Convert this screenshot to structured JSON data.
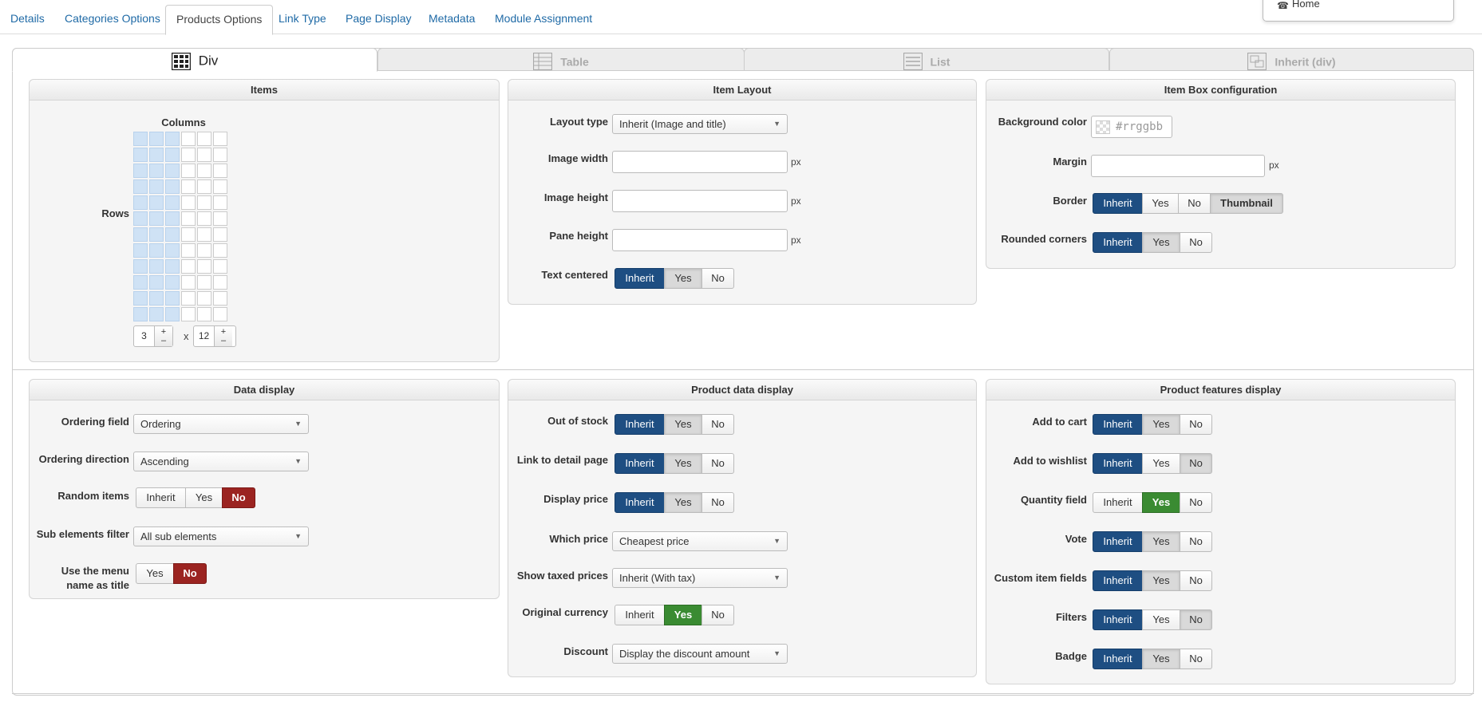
{
  "top_tabs": [
    "Details",
    "Categories Options",
    "Products Options",
    "Link Type",
    "Page Display",
    "Metadata",
    "Module Assignment"
  ],
  "home_menu": {
    "label": "Home",
    "icon": "home-icon"
  },
  "layout_tabs": [
    "Div",
    "Table",
    "List",
    "Inherit (div)"
  ],
  "items": {
    "title": "Items",
    "columns_label": "Columns",
    "rows_label": "Rows",
    "columns": "3",
    "rows": "12",
    "times": "x",
    "plus": "+",
    "minus": "–"
  },
  "item_layout": {
    "title": "Item Layout",
    "layout_type": {
      "label": "Layout type",
      "value": "Inherit (Image and title)"
    },
    "image_width": {
      "label": "Image width",
      "unit": "px"
    },
    "image_height": {
      "label": "Image height",
      "unit": "px"
    },
    "pane_height": {
      "label": "Pane height",
      "unit": "px"
    },
    "text_centered": {
      "label": "Text centered",
      "options": [
        "Inherit",
        "Yes",
        "No"
      ]
    }
  },
  "item_box": {
    "title": "Item Box configuration",
    "background_color": {
      "label": "Background color",
      "placeholder": "#rrggbb"
    },
    "margin": {
      "label": "Margin",
      "unit": "px"
    },
    "border": {
      "label": "Border",
      "options": [
        "Inherit",
        "Yes",
        "No",
        "Thumbnail"
      ]
    },
    "rounded_corners": {
      "label": "Rounded corners",
      "options": [
        "Inherit",
        "Yes",
        "No"
      ]
    }
  },
  "data_display": {
    "title": "Data display",
    "ordering_field": {
      "label": "Ordering field",
      "value": "Ordering"
    },
    "ordering_direction": {
      "label": "Ordering direction",
      "value": "Ascending"
    },
    "random_items": {
      "label": "Random items",
      "options": [
        "Inherit",
        "Yes",
        "No"
      ]
    },
    "sub_elements_filter": {
      "label": "Sub elements filter",
      "value": "All sub elements"
    },
    "menu_name_title": {
      "label_line1": "Use the menu",
      "label_line2": "name as title",
      "options": [
        "Yes",
        "No"
      ]
    }
  },
  "product_data_display": {
    "title": "Product data display",
    "out_of_stock": {
      "label": "Out of stock",
      "options": [
        "Inherit",
        "Yes",
        "No"
      ]
    },
    "link_to_detail": {
      "label": "Link to detail page",
      "options": [
        "Inherit",
        "Yes",
        "No"
      ]
    },
    "display_price": {
      "label": "Display price",
      "options": [
        "Inherit",
        "Yes",
        "No"
      ]
    },
    "which_price": {
      "label": "Which price",
      "value": "Cheapest price"
    },
    "show_taxed": {
      "label": "Show taxed prices",
      "value": "Inherit (With tax)"
    },
    "original_currency": {
      "label": "Original currency",
      "options": [
        "Inherit",
        "Yes",
        "No"
      ]
    },
    "discount": {
      "label": "Discount",
      "value": "Display the discount amount"
    }
  },
  "product_features": {
    "title": "Product features display",
    "add_to_cart": {
      "label": "Add to cart",
      "options": [
        "Inherit",
        "Yes",
        "No"
      ]
    },
    "add_to_wishlist": {
      "label": "Add to wishlist",
      "options": [
        "Inherit",
        "Yes",
        "No"
      ]
    },
    "quantity_field": {
      "label": "Quantity field",
      "options": [
        "Inherit",
        "Yes",
        "No"
      ]
    },
    "vote": {
      "label": "Vote",
      "options": [
        "Inherit",
        "Yes",
        "No"
      ]
    },
    "custom_item_fields": {
      "label": "Custom item fields",
      "options": [
        "Inherit",
        "Yes",
        "No"
      ]
    },
    "filters": {
      "label": "Filters",
      "options": [
        "Inherit",
        "Yes",
        "No"
      ]
    },
    "badge": {
      "label": "Badge",
      "options": [
        "Inherit",
        "Yes",
        "No"
      ]
    }
  },
  "colors": {
    "selected_blue": "#1e4e82",
    "selected_red": "#9b2421",
    "selected_green": "#3a8b32",
    "link_blue": "#1f6aa6",
    "grid_selected": "#cfe2f5"
  }
}
